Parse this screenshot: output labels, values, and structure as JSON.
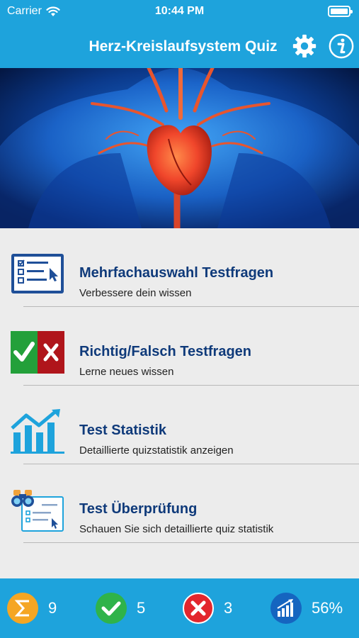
{
  "status_bar": {
    "carrier": "Carrier",
    "time": "10:44 PM"
  },
  "nav": {
    "title": "Herz-Kreislaufsystem Quiz",
    "settings_icon": "gear-icon",
    "info_icon": "info-icon"
  },
  "hero": {
    "image": "heart-anatomy-illustration"
  },
  "menu": {
    "items": [
      {
        "label": "Mehrfachauswahl Testfragen",
        "subtitle": "Verbessere dein wissen",
        "icon": "multiple-choice-icon"
      },
      {
        "label": "Richtig/Falsch Testfragen",
        "subtitle": "Lerne neues wissen",
        "icon": "true-false-icon"
      },
      {
        "label": "Test Statistik",
        "subtitle": "Detaillierte quizstatistik anzeigen",
        "icon": "statistics-chart-icon"
      },
      {
        "label": "Test Überprüfung",
        "subtitle": "Schauen Sie sich detaillierte quiz statistik",
        "icon": "review-binoculars-icon"
      }
    ]
  },
  "footer": {
    "total": "9",
    "correct": "5",
    "wrong": "3",
    "percent": "56%"
  },
  "colors": {
    "primary": "#1ea3dc",
    "title": "#0f3a7a",
    "correct": "#2fb34a",
    "wrong": "#e3262d",
    "total": "#f5a623"
  }
}
